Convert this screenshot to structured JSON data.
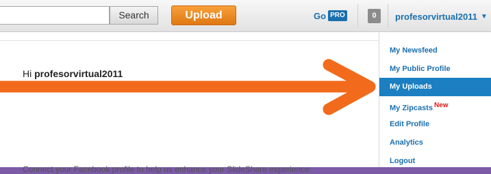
{
  "header": {
    "search_label": "Search",
    "upload_label": "Upload",
    "go_label": "Go",
    "pro_label": "PRO",
    "notification_count": "0",
    "username": "profesorvirtual2011",
    "caret": "▼"
  },
  "main": {
    "greeting_prefix": "Hi ",
    "greeting_name": "profesorvirtual2011",
    "facebook_note": "Connect your Facebook profile to help us enhance your SlideShare experience"
  },
  "menu": {
    "items": [
      {
        "label": "My Newsfeed"
      },
      {
        "label": "My Public Profile"
      },
      {
        "label": "My Uploads"
      },
      {
        "label": "My Zipcasts",
        "badge": "New"
      },
      {
        "label": "Edit Profile"
      },
      {
        "label": "Analytics"
      },
      {
        "label": "Logout"
      }
    ]
  },
  "annotation": {
    "arrow_color": "#f26a1b"
  },
  "colors": {
    "frame": "#7b5aa6",
    "link": "#1a6fae",
    "active_item": "#1b7fc1",
    "upload": "#ee8a22",
    "new_badge": "#e01919"
  }
}
